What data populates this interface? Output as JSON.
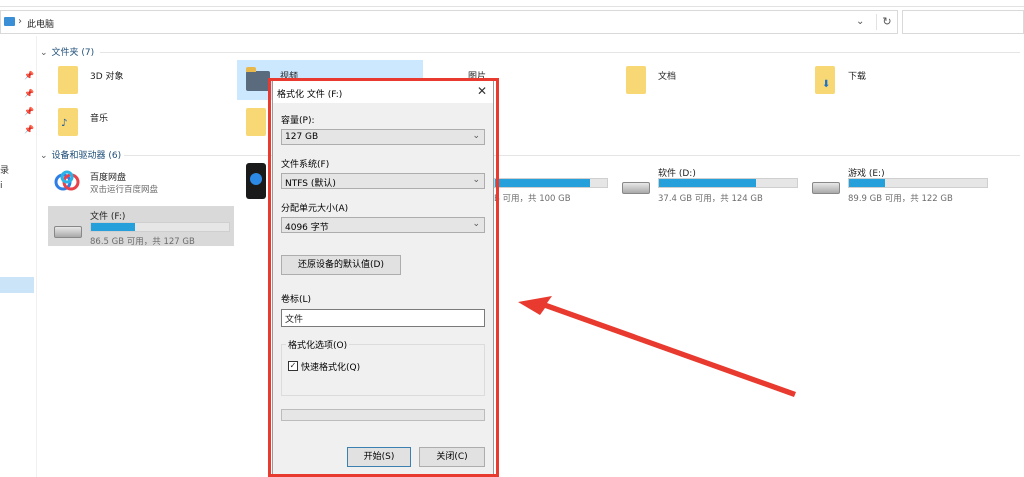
{
  "address": {
    "location": "此电脑"
  },
  "nav": {
    "items": [
      "录",
      "i"
    ]
  },
  "groups": {
    "folders": {
      "header": "文件夹 (7)"
    },
    "drives": {
      "header": "设备和驱动器 (6)"
    }
  },
  "folders": [
    {
      "label": "3D 对象"
    },
    {
      "label": "视频"
    },
    {
      "label": "图片"
    },
    {
      "label": "文档"
    },
    {
      "label": "下载"
    },
    {
      "label": "音乐"
    }
  ],
  "drives": {
    "baidu": {
      "label": "百度网盘",
      "sub": "双击运行百度网盘"
    },
    "wenjian": {
      "label": "文件 (F:)",
      "sub": "86.5 GB 可用，共 127 GB",
      "used_fraction": 0.32
    },
    "hidden": {
      "sub": "B 可用，共 100 GB",
      "used_fraction": 0.85
    },
    "ruanjian": {
      "label": "软件 (D:)",
      "sub": "37.4 GB 可用，共 124 GB",
      "used_fraction": 0.7
    },
    "youxi": {
      "label": "游戏 (E:)",
      "sub": "89.9 GB 可用，共 122 GB",
      "used_fraction": 0.26
    }
  },
  "dialog": {
    "title": "格式化 文件 (F:)",
    "close": "✕",
    "capacity_label": "容量(P):",
    "capacity_value": "127 GB",
    "filesystem_label": "文件系统(F)",
    "filesystem_value": "NTFS (默认)",
    "alloc_label": "分配单元大小(A)",
    "alloc_value": "4096 字节",
    "restore_button": "还原设备的默认值(D)",
    "volume_label": "卷标(L)",
    "volume_value": "文件",
    "options_label": "格式化选项(O)",
    "quick_format_label": "快速格式化(Q)",
    "quick_format_checked": "✓",
    "start_button": "开始(S)",
    "close_button": "关闭(C)"
  },
  "colors": {
    "accent": "#26a0da",
    "highlight": "#e83a2e"
  }
}
